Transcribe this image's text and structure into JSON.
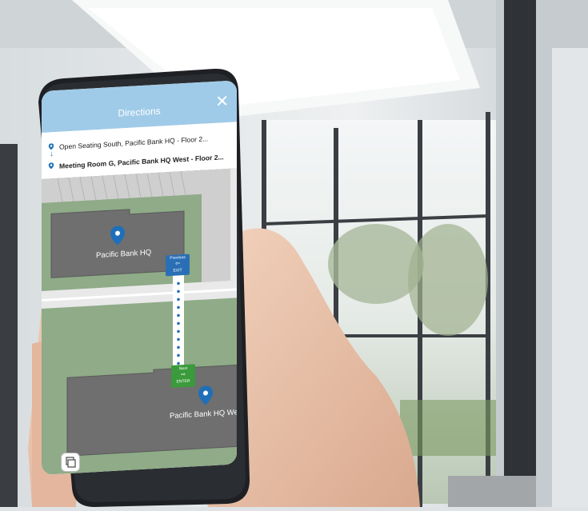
{
  "header": {
    "title": "Directions"
  },
  "route": {
    "from": "Open Seating South, Pacific Bank HQ - Floor 2...",
    "to": "Meeting Room G, Pacific Bank HQ West - Floor 2..."
  },
  "map": {
    "building_1": "Pacific Bank HQ",
    "building_2": "Pacific Bank HQ West",
    "exit_tag_top": "Previous",
    "exit_tag_bottom": "EXIT",
    "enter_tag_top": "Next",
    "enter_tag_bottom": "ENTER"
  },
  "colors": {
    "header": "#9fcbe8",
    "pin": "#1f6fb8",
    "exit": "#2a6fb5",
    "enter": "#3b9a3b",
    "ground": "#8fab88",
    "building": "#6f6f6f"
  }
}
